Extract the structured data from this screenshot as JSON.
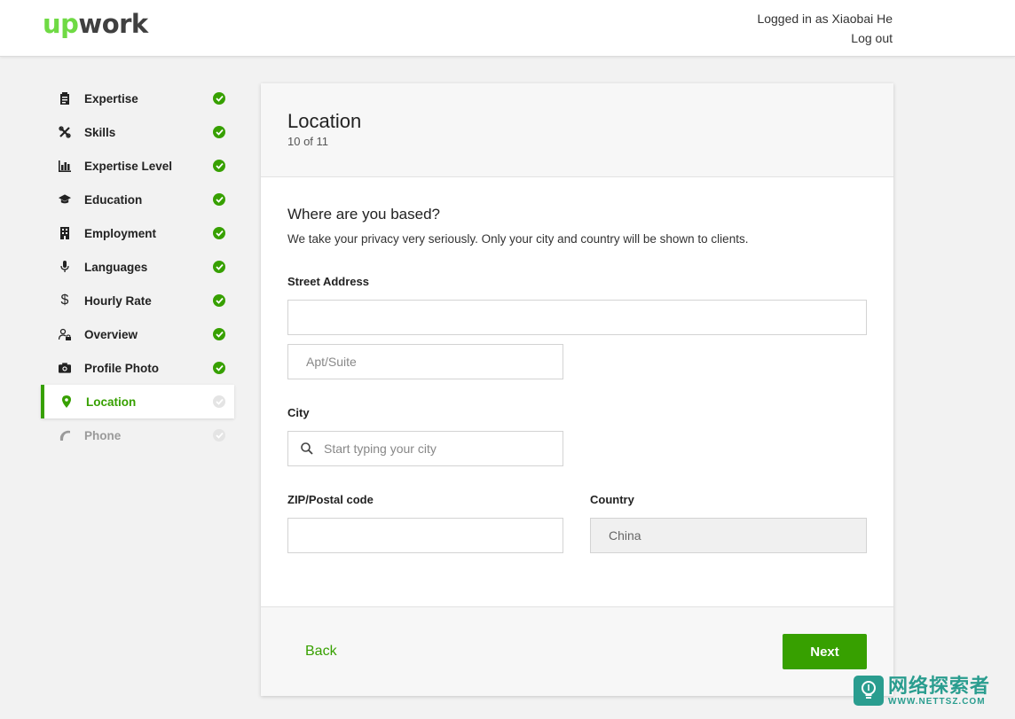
{
  "header": {
    "logo_up": "up",
    "logo_work": "work",
    "logged_in_text": "Logged in as Xiaobai He",
    "logout_label": "Log out"
  },
  "sidebar": {
    "items": [
      {
        "label": "Expertise",
        "icon": "clipboard-icon",
        "status": "complete"
      },
      {
        "label": "Skills",
        "icon": "tools-icon",
        "status": "complete"
      },
      {
        "label": "Expertise Level",
        "icon": "bar-chart-icon",
        "status": "complete"
      },
      {
        "label": "Education",
        "icon": "graduation-cap-icon",
        "status": "complete"
      },
      {
        "label": "Employment",
        "icon": "building-icon",
        "status": "complete"
      },
      {
        "label": "Languages",
        "icon": "microphone-icon",
        "status": "complete"
      },
      {
        "label": "Hourly Rate",
        "icon": "dollar-icon",
        "status": "complete"
      },
      {
        "label": "Overview",
        "icon": "person-lock-icon",
        "status": "complete"
      },
      {
        "label": "Profile Photo",
        "icon": "camera-icon",
        "status": "complete"
      },
      {
        "label": "Location",
        "icon": "map-pin-icon",
        "status": "active"
      },
      {
        "label": "Phone",
        "icon": "phone-icon",
        "status": "disabled"
      }
    ]
  },
  "card": {
    "title": "Location",
    "step": "10 of 11",
    "section_title": "Where are you based?",
    "section_subtitle": "We take your privacy very seriously. Only your city and country will be shown to clients.",
    "street_label": "Street Address",
    "street_value": "",
    "apt_placeholder": "Apt/Suite",
    "city_label": "City",
    "city_placeholder": "Start typing your city",
    "zip_label": "ZIP/Postal code",
    "zip_value": "",
    "country_label": "Country",
    "country_value": "China",
    "back_label": "Back",
    "next_label": "Next"
  },
  "watermark": {
    "chinese": "网络探索者",
    "url": "WWW.NETTSZ.COM"
  },
  "colors": {
    "accent_green": "#37a000",
    "logo_green": "#6fda44",
    "watermark_teal": "#2a9d8f"
  }
}
